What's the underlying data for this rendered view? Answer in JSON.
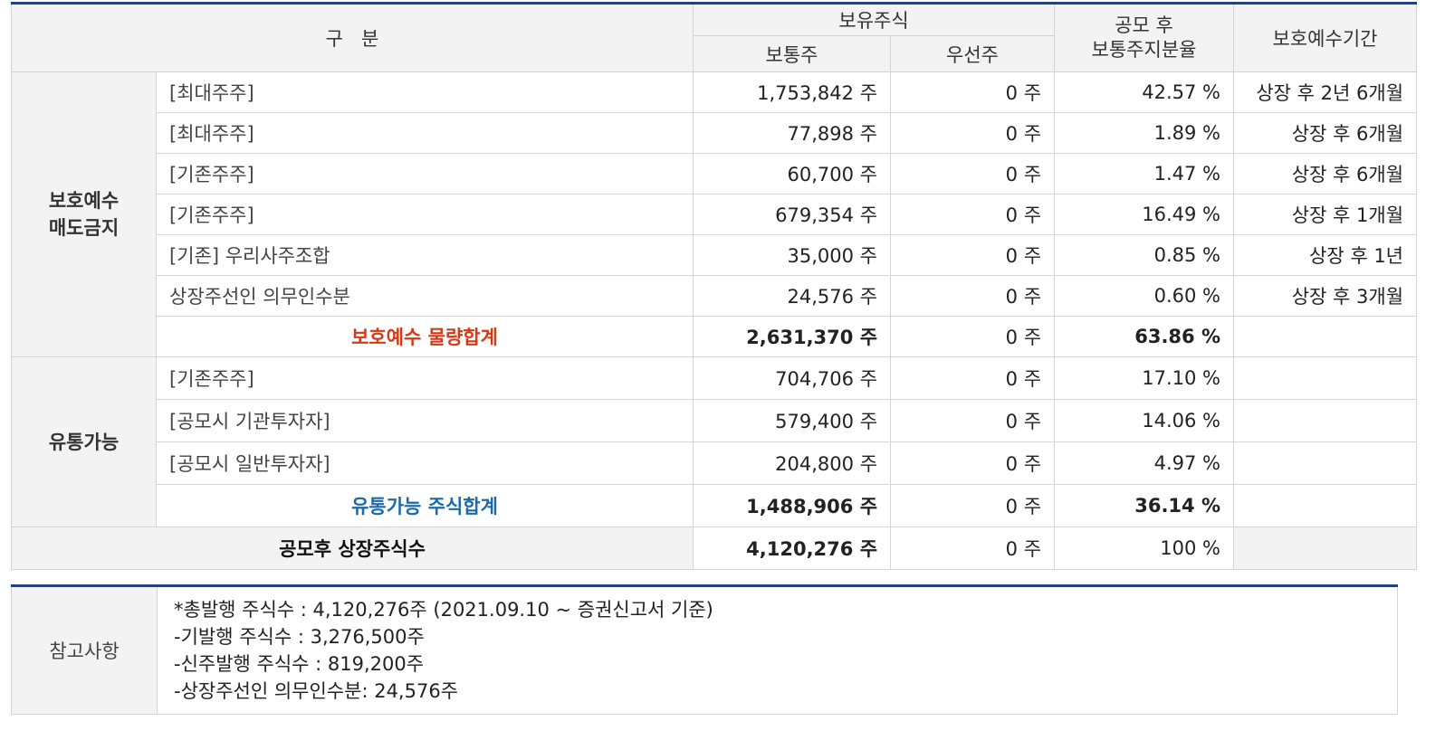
{
  "header": {
    "category": "구   분",
    "holdings": "보유주식",
    "common": "보통주",
    "preferred": "우선주",
    "ratio": "공모 후\n보통주지분율",
    "ratio_line1": "공모 후",
    "ratio_line2": "보통주지분율",
    "lockup_period": "보호예수기간"
  },
  "lockup_group": {
    "label_line1": "보호예수",
    "label_line2": "매도금지",
    "rows": [
      {
        "name": "[최대주주]",
        "common": "1,753,842 주",
        "preferred": "0 주",
        "ratio": "42.57 %",
        "period": "상장 후 2년 6개월"
      },
      {
        "name": "[최대주주]",
        "common": "77,898 주",
        "preferred": "0 주",
        "ratio": "1.89 %",
        "period": "상장 후 6개월"
      },
      {
        "name": "[기존주주]",
        "common": "60,700 주",
        "preferred": "0 주",
        "ratio": "1.47 %",
        "period": "상장 후 6개월"
      },
      {
        "name": "[기존주주]",
        "common": "679,354 주",
        "preferred": "0 주",
        "ratio": "16.49 %",
        "period": "상장 후 1개월"
      },
      {
        "name": "[기존] 우리사주조합",
        "common": "35,000 주",
        "preferred": "0 주",
        "ratio": "0.85 %",
        "period": "상장 후 1년"
      },
      {
        "name": "상장주선인 의무인수분",
        "common": "24,576 주",
        "preferred": "0 주",
        "ratio": "0.60 %",
        "period": "상장 후 3개월"
      }
    ],
    "subtotal": {
      "name": "보호예수 물량합계",
      "common": "2,631,370 주",
      "preferred": "0 주",
      "ratio": "63.86 %",
      "period": ""
    }
  },
  "float_group": {
    "label": "유통가능",
    "rows": [
      {
        "name": "[기존주주]",
        "common": "704,706 주",
        "preferred": "0 주",
        "ratio": "17.10 %",
        "period": ""
      },
      {
        "name": "[공모시 기관투자자]",
        "common": "579,400 주",
        "preferred": "0 주",
        "ratio": "14.06 %",
        "period": ""
      },
      {
        "name": "[공모시 일반투자자]",
        "common": "204,800 주",
        "preferred": "0 주",
        "ratio": "4.97 %",
        "period": ""
      }
    ],
    "subtotal": {
      "name": "유통가능 주식합계",
      "common": "1,488,906 주",
      "preferred": "0 주",
      "ratio": "36.14 %",
      "period": ""
    }
  },
  "total": {
    "name": "공모후 상장주식수",
    "common": "4,120,276 주",
    "preferred": "0 주",
    "ratio": "100 %",
    "period": ""
  },
  "notes": {
    "label": "참고사항",
    "lines": [
      "*총발행 주식수 : 4,120,276주 (2021.09.10 ~ 증권신고서 기준)",
      "-기발행 주식수 : 3,276,500주",
      "-신주발행 주식수 : 819,200주",
      "-상장주선인 의무인수분: 24,576주"
    ]
  },
  "colors": {
    "header_border": "#24427a",
    "header_bg": "#f3f3f3",
    "lock_total": "#d23a18",
    "float_total": "#1e6aa6",
    "grid": "#d4d4d4"
  }
}
